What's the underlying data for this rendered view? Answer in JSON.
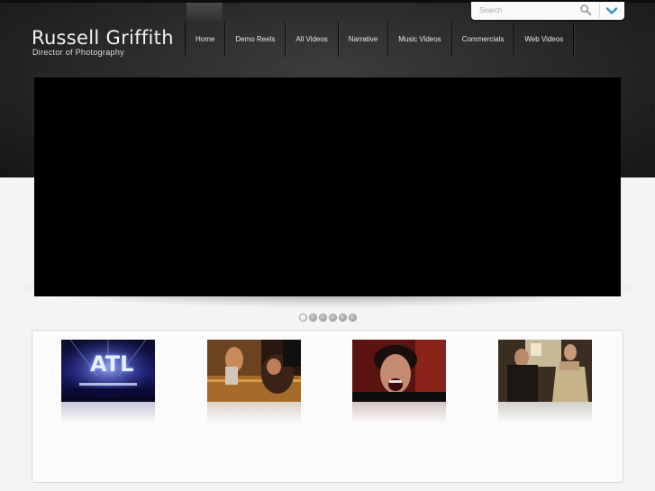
{
  "header": {
    "brand_name": "Russell Griffith",
    "brand_subtitle": "Director of Photography"
  },
  "nav": {
    "items": [
      "Home",
      "Demo Reels",
      "All Videos",
      "Narrative",
      "Music Videos",
      "Commercials",
      "Web Videos"
    ],
    "active_index": 0
  },
  "search": {
    "placeholder": "Search",
    "icon": "magnifier-icon",
    "toggle_icon": "chevron-down-icon"
  },
  "slider": {
    "dot_count": 6,
    "active_dot": 0
  },
  "thumbnails": [
    {
      "name": "thumbnail-atl",
      "text": "ATL"
    },
    {
      "name": "thumbnail-rooftop",
      "text": ""
    },
    {
      "name": "thumbnail-screaming-man",
      "text": ""
    },
    {
      "name": "thumbnail-dancing-couple",
      "text": ""
    }
  ],
  "colors": {
    "header_dark": "#1e1e1e",
    "accent_blue": "#3a8fd6",
    "page_bg": "#f4f4f4"
  }
}
